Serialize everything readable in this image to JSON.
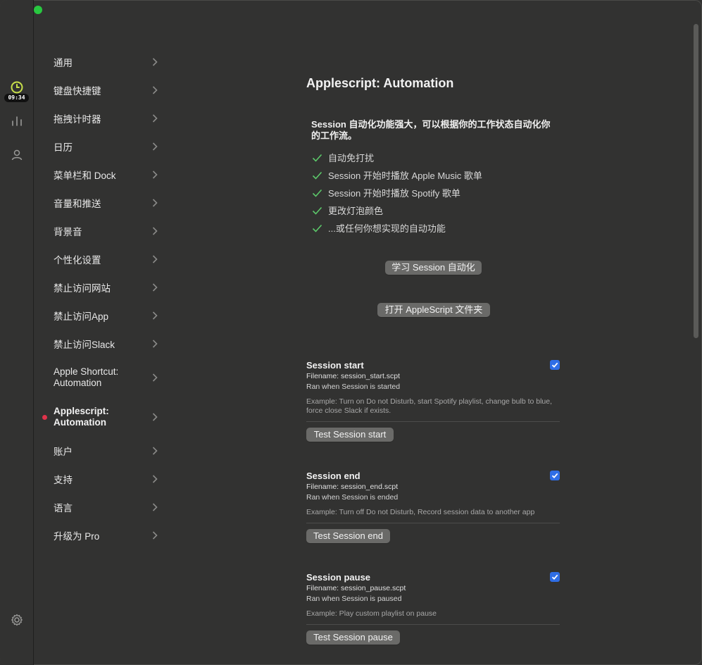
{
  "rail": {
    "time_badge": "09:34"
  },
  "nav": {
    "items": [
      {
        "label": "通用"
      },
      {
        "label": "键盘快捷键"
      },
      {
        "label": "拖拽计时器"
      },
      {
        "label": "日历"
      },
      {
        "label": "菜单栏和 Dock"
      },
      {
        "label": "音量和推送"
      },
      {
        "label": "背景音"
      },
      {
        "label": "个性化设置"
      },
      {
        "label": "禁止访问网站"
      },
      {
        "label": "禁止访问App"
      },
      {
        "label": "禁止访问Slack"
      },
      {
        "label_line1": "Apple Shortcut:",
        "label_line2": "Automation"
      },
      {
        "label_line1": "Applescript:",
        "label_line2": "Automation"
      },
      {
        "label": "账户"
      },
      {
        "label": "支持"
      },
      {
        "label": "语言"
      },
      {
        "label": "升级为 Pro"
      }
    ]
  },
  "main": {
    "title": "Applescript: Automation",
    "intro": "Session 自动化功能强大，可以根据你的工作状态自动化你的工作流。",
    "features": [
      "自动免打扰",
      "Session 开始时播放 Apple Music 歌单",
      "Session 开始时播放 Spotify 歌单",
      "更改灯泡颜色",
      "...或任何你想实现的自动功能"
    ],
    "learn_button": "学习 Session 自动化",
    "open_folder_button": "打开 AppleScript 文件夹",
    "sections": [
      {
        "title": "Session start",
        "filename": "Filename: session_start.scpt",
        "ran_when": "Ran when Session is started",
        "example": "Example: Turn on Do not Disturb, start Spotify playlist, change bulb to blue, force close Slack if exists.",
        "button": "Test Session start",
        "checked": true
      },
      {
        "title": "Session end",
        "filename": "Filename: session_end.scpt",
        "ran_when": "Ran when Session is ended",
        "example": "Example: Turn off Do not Disturb, Record session data to another app",
        "button": "Test Session end",
        "checked": true
      },
      {
        "title": "Session pause",
        "filename": "Filename: session_pause.scpt",
        "ran_when": "Ran when Session is paused",
        "example": "Example: Play custom playlist on pause",
        "button": "Test Session pause",
        "checked": true
      }
    ]
  },
  "colors": {
    "background": "#323231",
    "accent_blue": "#2f6ee6",
    "active_dot": "#e0334a",
    "clock_green": "#c8e04a",
    "check_green": "#5cc86a"
  }
}
